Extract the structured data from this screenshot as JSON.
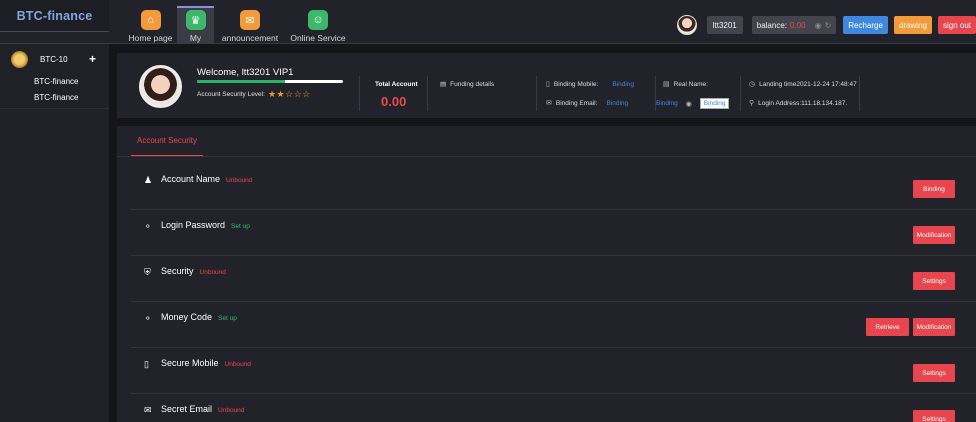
{
  "logo": "BTC-finance",
  "nav": [
    {
      "label": "Home page",
      "icon": "home-icon",
      "color": "#f39a3a"
    },
    {
      "label": "My",
      "icon": "crown-icon",
      "color": "#3db86a"
    },
    {
      "label": "announcement",
      "icon": "mail-icon",
      "color": "#f39a3a"
    },
    {
      "label": "Online Service",
      "icon": "support-icon",
      "color": "#3db86a"
    }
  ],
  "topbar": {
    "username": "ltt3201",
    "balance_label": "balance:",
    "balance_value": "0.00",
    "recharge": "Recharge",
    "drawing": "drawing",
    "signout": "sign out"
  },
  "sidebar": {
    "title": "BTC-10",
    "plus": "+",
    "items": [
      "BTC-finance",
      "BTC-finance"
    ]
  },
  "profile": {
    "welcome": "Welcome, ltt3201 VIP1",
    "security_level_label": "Account Security Level:",
    "security_stars": 2,
    "security_stars_max": 5,
    "security_progress": 0.6,
    "total_label": "Total Account",
    "total_value": "0.00",
    "funding": "Funding details",
    "binding_mobile_label": "Binding Mobile:",
    "binding_mobile_value": "Binding",
    "binding_email_label": "Binding Email:",
    "binding_email_value": "Binding",
    "real_name_label": "Real Name:",
    "binding_link": "Binding",
    "qq_binding": "Binding",
    "landing_time": "Landing time2021-12-24 17:48:47",
    "login_address": "Login Address:111.18.134.187."
  },
  "security": {
    "tab": "Account Security",
    "rows": [
      {
        "name": "Account Name",
        "status": "Unbound",
        "status_type": "unbound",
        "icon": "user-icon",
        "actions": [
          "Binding"
        ]
      },
      {
        "name": "Login Password",
        "status": "Set up",
        "status_type": "set",
        "icon": "lock-icon",
        "actions": [
          "Modification"
        ]
      },
      {
        "name": "Security",
        "status": "Unbound",
        "status_type": "unbound",
        "icon": "shield-icon",
        "actions": [
          "Settings"
        ]
      },
      {
        "name": "Money Code",
        "status": "Set up",
        "status_type": "set",
        "icon": "lock-icon",
        "actions": [
          "Retrieve",
          "Modification"
        ]
      },
      {
        "name": "Secure Mobile",
        "status": "Unbound",
        "status_type": "unbound",
        "icon": "phone-icon",
        "actions": [
          "Settings"
        ]
      },
      {
        "name": "Secret Email",
        "status": "Unbound",
        "status_type": "unbound",
        "icon": "envelope-icon",
        "actions": [
          "Settings"
        ]
      }
    ]
  },
  "colors": {
    "accent_red": "#e84a4a",
    "link_blue": "#3f88e0",
    "green": "#28b464",
    "orange": "#f39a3a"
  }
}
